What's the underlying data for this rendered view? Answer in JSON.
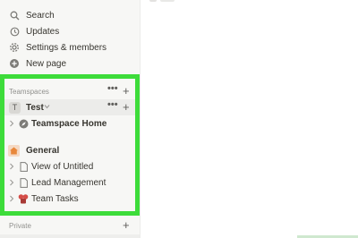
{
  "sidebar": {
    "top_items": [
      {
        "label": "Search",
        "icon": "search-icon"
      },
      {
        "label": "Updates",
        "icon": "clock-icon"
      },
      {
        "label": "Settings & members",
        "icon": "gear-icon"
      },
      {
        "label": "New page",
        "icon": "plus-circle-icon"
      }
    ],
    "teamspaces_header": "Teamspaces",
    "test_team": {
      "label": "Test",
      "initial": "T"
    },
    "pages": [
      {
        "label": "Teamspace Home",
        "icon": "compass-icon"
      },
      {
        "label": "General",
        "icon": "house-icon"
      },
      {
        "label": "View of Untitled",
        "icon": "page-icon"
      },
      {
        "label": "Lead Management",
        "icon": "page-icon"
      },
      {
        "label": "Team Tasks",
        "icon": "ribbon-icon"
      }
    ],
    "private_header": "Private"
  },
  "colors": {
    "sidebar_bg": "#f7f7f5",
    "highlight": "#3ddc3a",
    "team_row_bg": "#ececea",
    "general_icon": "#e8873a",
    "ribbon_icon": "#d44c47"
  }
}
